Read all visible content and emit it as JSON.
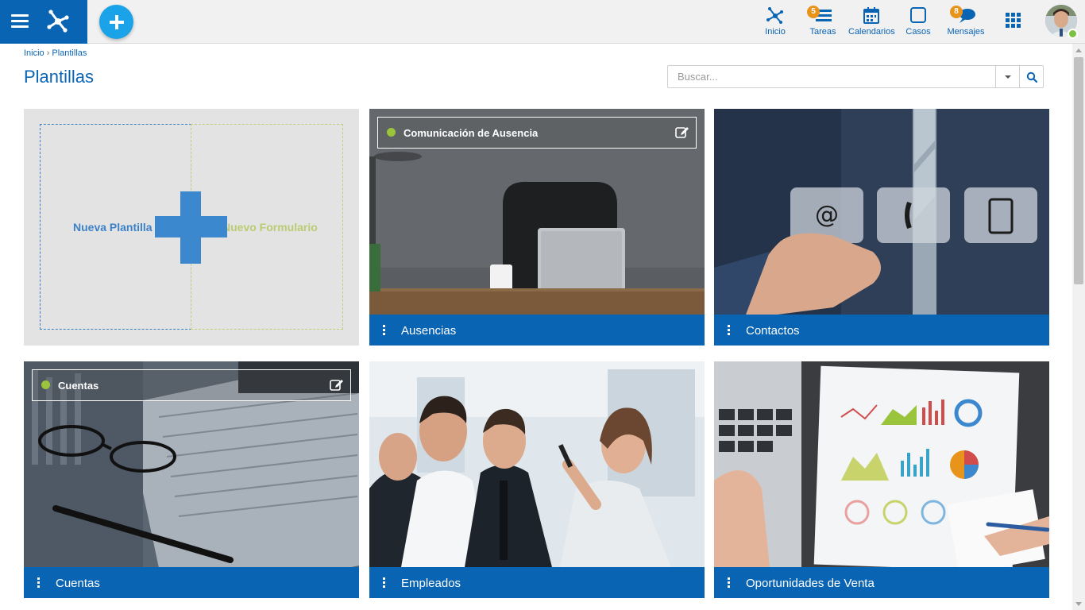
{
  "nav": {
    "items": [
      {
        "label": "Inicio",
        "icon": "network-icon"
      },
      {
        "label": "Tareas",
        "icon": "tasks-icon",
        "badge": "5"
      },
      {
        "label": "Calendarios",
        "icon": "calendar-icon"
      },
      {
        "label": "Casos",
        "icon": "case-icon"
      },
      {
        "label": "Mensajes",
        "icon": "chat-icon",
        "badge": "8"
      }
    ]
  },
  "breadcrumb": {
    "home": "Inicio",
    "separator": "›",
    "current": "Plantillas"
  },
  "page": {
    "title": "Plantillas"
  },
  "search": {
    "placeholder": "Buscar..."
  },
  "new_card": {
    "template_label": "Nueva Plantilla",
    "form_label": "Nuevo Formulario"
  },
  "cards": [
    {
      "name": "Ausencias",
      "overlay_title": "Comunicación de Ausencia"
    },
    {
      "name": "Contactos"
    },
    {
      "name": "Cuentas",
      "overlay_title": "Cuentas"
    },
    {
      "name": "Empleados"
    },
    {
      "name": "Oportunidades de Venta"
    }
  ],
  "colors": {
    "brand": "#0a64b4",
    "fab": "#1aa3e8",
    "badge": "#e8931a",
    "online": "#7cc242",
    "status_dot": "#9ac43c"
  }
}
